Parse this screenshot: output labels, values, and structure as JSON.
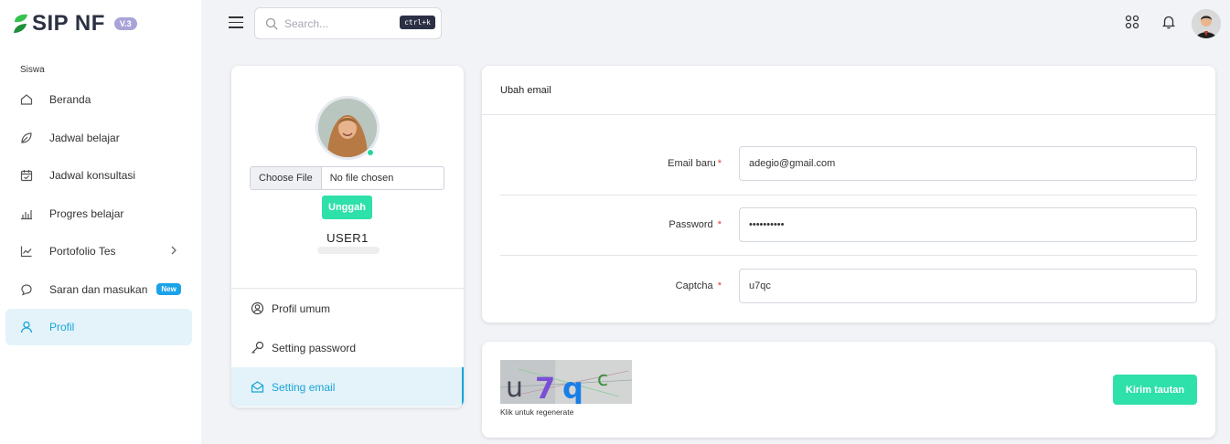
{
  "app": {
    "name": "SIP NF",
    "version": "V.3"
  },
  "sidebar": {
    "section": "Siswa",
    "items": [
      {
        "label": "Beranda",
        "icon": "home-icon"
      },
      {
        "label": "Jadwal belajar",
        "icon": "leaf-icon"
      },
      {
        "label": "Jadwal konsultasi",
        "icon": "calendar-icon"
      },
      {
        "label": "Progres belajar",
        "icon": "bar-chart-icon"
      },
      {
        "label": "Portofolio Tes",
        "icon": "line-chart-icon"
      },
      {
        "label": "Saran dan masukan",
        "icon": "chat-icon",
        "badge": "New"
      },
      {
        "label": "Profil",
        "icon": "user-icon",
        "active": true
      }
    ]
  },
  "topbar": {
    "search_placeholder": "Search...",
    "search_shortcut": "ctrl+k"
  },
  "profile": {
    "file_button": "Choose File",
    "file_name": "No file chosen",
    "upload_label": "Unggah",
    "username": "USER1",
    "menu": [
      {
        "label": "Profil umum",
        "icon": "user-circle-icon"
      },
      {
        "label": "Setting password",
        "icon": "key-icon"
      },
      {
        "label": "Setting email",
        "icon": "envelope-open-icon",
        "active": true
      }
    ]
  },
  "email_form": {
    "title": "Ubah email",
    "fields": [
      {
        "label": "Email baru",
        "value": "adegio@gmail.com"
      },
      {
        "label": "Password",
        "value": "••••••••••"
      },
      {
        "label": "Captcha",
        "value": "u7qc"
      }
    ]
  },
  "captcha": {
    "text": "u7qc",
    "hint": "Klik untuk regenerate",
    "submit_label": "Kirim tautan"
  },
  "colors": {
    "accent": "#19a4d8",
    "primary_button": "#2ee0aa",
    "required": "#e53d3d"
  }
}
